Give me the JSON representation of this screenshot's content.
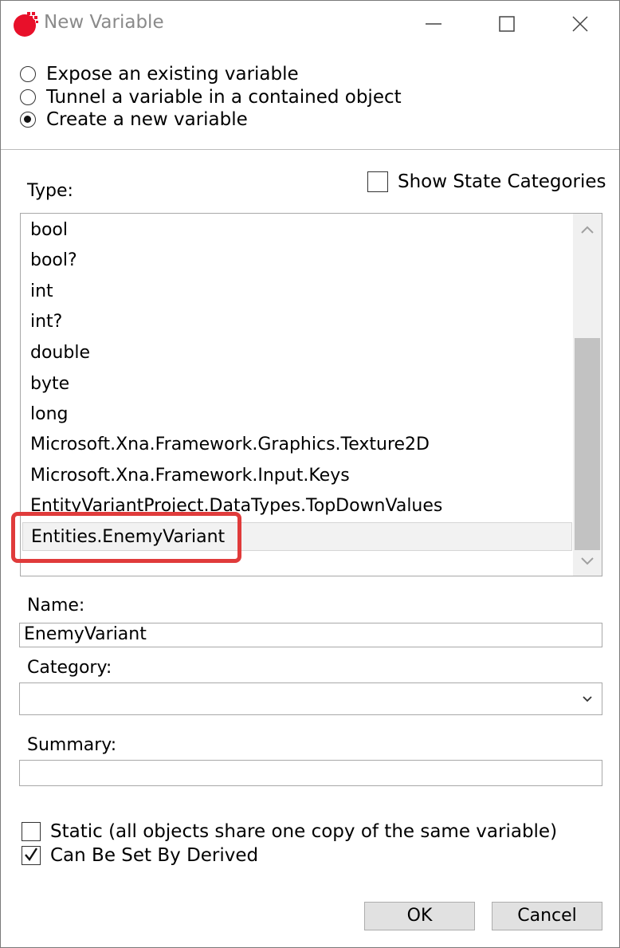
{
  "window": {
    "title": "New Variable",
    "accent_color": "#e8102a"
  },
  "options": [
    {
      "label": "Expose an existing variable",
      "selected": false
    },
    {
      "label": "Tunnel a variable in a contained object",
      "selected": false
    },
    {
      "label": "Create a new variable",
      "selected": true
    }
  ],
  "type_section": {
    "label": "Type:",
    "show_state_categories": {
      "label": "Show State Categories",
      "checked": false
    },
    "items": [
      "bool",
      "bool?",
      "int",
      "int?",
      "double",
      "byte",
      "long",
      "Microsoft.Xna.Framework.Graphics.Texture2D",
      "Microsoft.Xna.Framework.Input.Keys",
      "EntityVariantProject.DataTypes.TopDownValues",
      "Entities.EnemyVariant"
    ],
    "selected_item": "Entities.EnemyVariant",
    "highlight_color": "#e03b3b"
  },
  "name": {
    "label": "Name:",
    "value": "EnemyVariant"
  },
  "category": {
    "label": "Category:",
    "value": ""
  },
  "summary": {
    "label": "Summary:",
    "value": ""
  },
  "flags": {
    "static": {
      "label": "Static (all objects share one copy of the same variable)",
      "checked": false
    },
    "derived": {
      "label": "Can Be Set By Derived",
      "checked": true
    }
  },
  "buttons": {
    "ok": "OK",
    "cancel": "Cancel"
  }
}
